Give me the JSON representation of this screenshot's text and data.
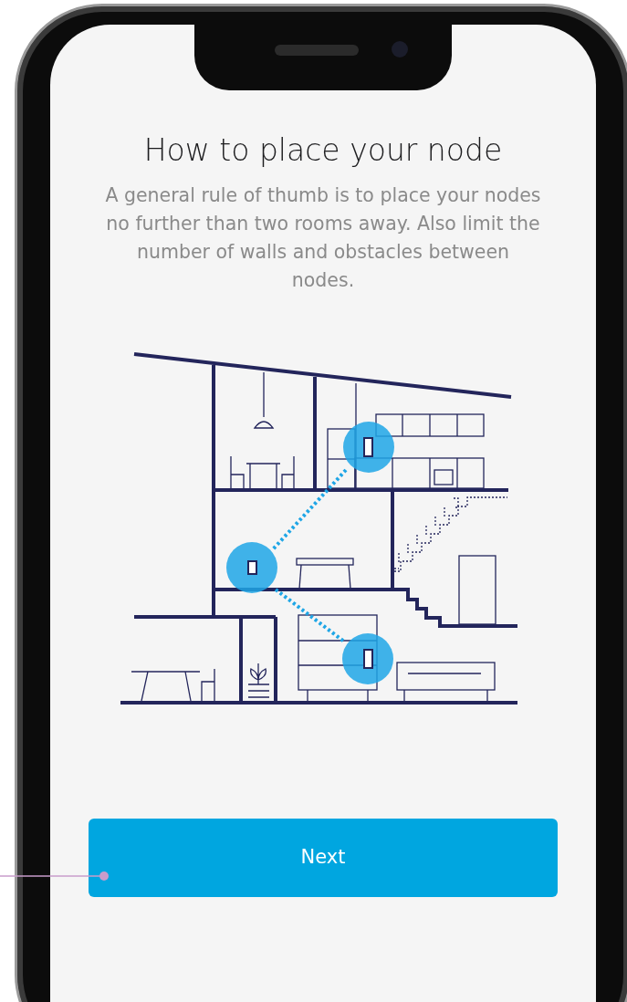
{
  "title": "How to place your node",
  "description": "A general rule of thumb is to place your nodes no further than two rooms away. Also limit the number of walls and obstacles between nodes.",
  "next_button": {
    "label": "Next"
  }
}
